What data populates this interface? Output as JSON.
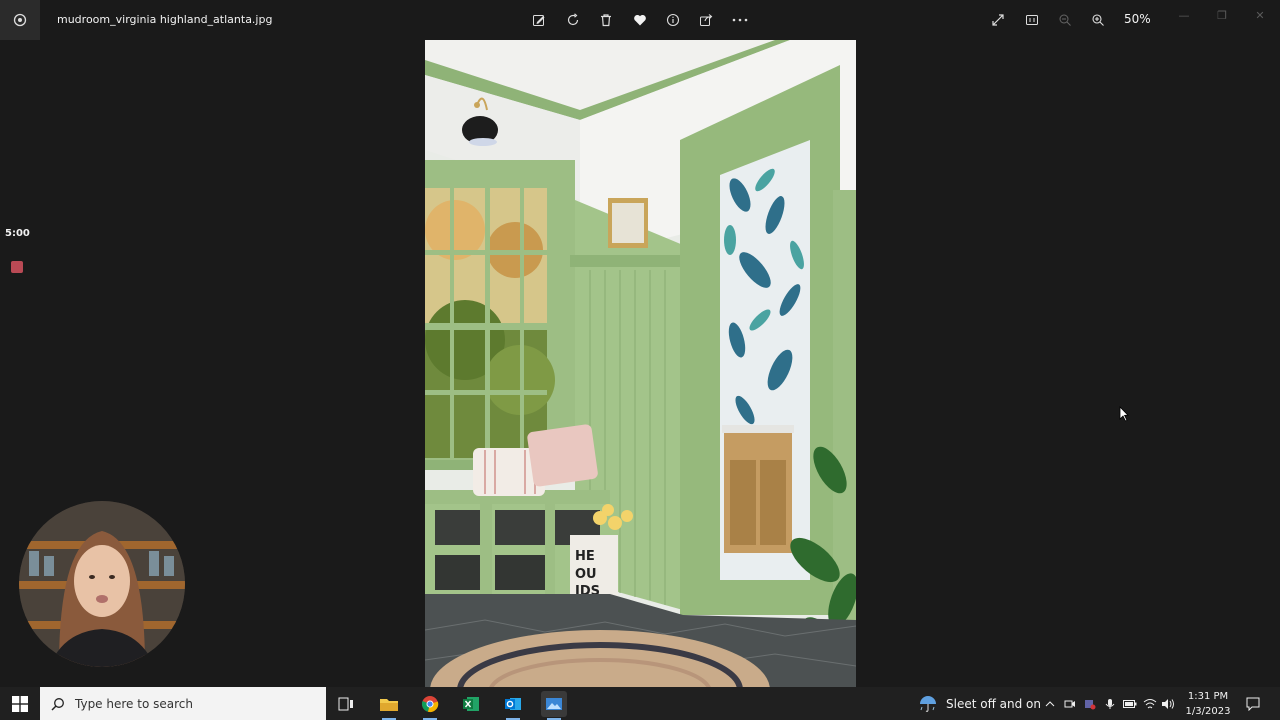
{
  "titlebar": {
    "file_name": "mudroom_virginia highland_atlanta.jpg",
    "zoom": "50%",
    "toolbar_icons": [
      "edit-icon",
      "rotate-icon",
      "delete-icon",
      "favorite-heart-icon",
      "info-icon",
      "share-icon",
      "more-icon"
    ],
    "view_icons": [
      "fullscreen-icon",
      "actual-size-icon",
      "zoom-out-icon",
      "zoom-in-icon"
    ]
  },
  "recording": {
    "timer": "5:00"
  },
  "taskbar": {
    "search_placeholder": "Type here to search",
    "weather": "Sleet off and on",
    "time": "1:31 PM",
    "date": "1/3/2023"
  },
  "colors": {
    "background": "#1a1a1a",
    "taskbar": "#202020",
    "wall_green": "#9dbe84",
    "record_red": "#b94a55"
  }
}
